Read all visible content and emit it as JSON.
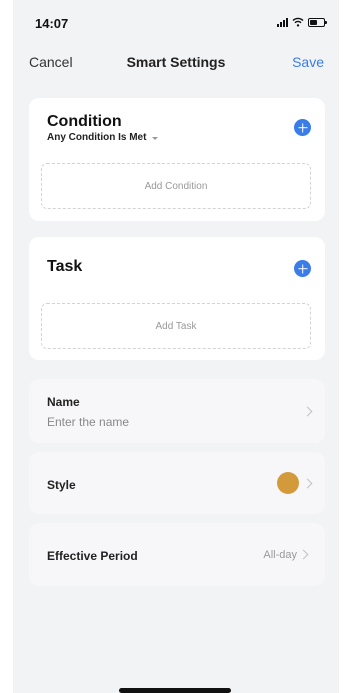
{
  "status_bar": {
    "time": "14:07"
  },
  "nav": {
    "cancel_label": "Cancel",
    "title": "Smart Settings",
    "save_label": "Save"
  },
  "condition": {
    "title": "Condition",
    "match_mode": "Any Condition Is Met",
    "add_label": "Add Condition"
  },
  "task": {
    "title": "Task",
    "add_label": "Add Task"
  },
  "name_row": {
    "label": "Name",
    "placeholder": "Enter the name"
  },
  "style_row": {
    "label": "Style",
    "color": "#d39a3c"
  },
  "period_row": {
    "label": "Effective Period",
    "value": "All-day"
  },
  "colors": {
    "accent": "#3a7de8",
    "background": "#f2f3f5"
  },
  "icons": {
    "add": "plus-circle-icon",
    "chevron": "chevron-right-icon",
    "caret": "caret-down-icon"
  }
}
